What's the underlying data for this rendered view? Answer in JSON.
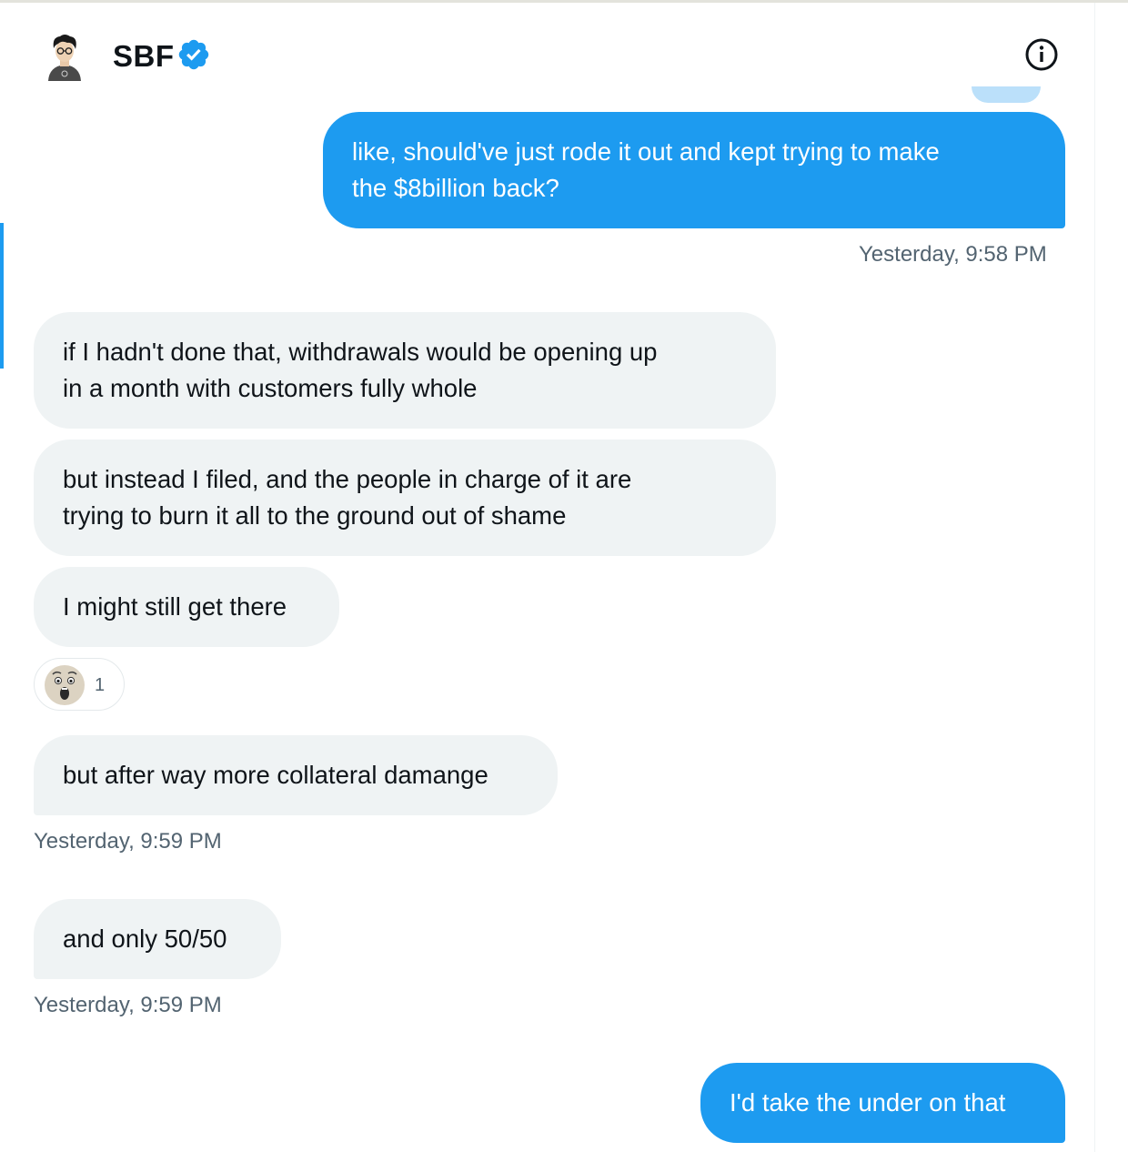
{
  "header": {
    "contact_name": "SBF",
    "verified_icon": "verified-badge-icon",
    "info_icon": "info-icon"
  },
  "colors": {
    "accent": "#1d9bf0",
    "received_bubble": "#eff3f4",
    "text_primary": "#0f1419",
    "text_secondary": "#536471"
  },
  "messages": [
    {
      "direction": "sent",
      "text_line1": "like, should've just rode it out and kept trying to make",
      "text_line2": "the $8billion back?"
    },
    {
      "direction": "received",
      "text_line1": "if I hadn't done that, withdrawals would be opening up",
      "text_line2": "in a month with customers fully whole"
    },
    {
      "direction": "received",
      "text_line1": "but instead I filed, and the people in charge of it are",
      "text_line2": "trying to burn it all to the ground out of shame"
    },
    {
      "direction": "received",
      "text": "I might still get there"
    },
    {
      "direction": "received",
      "text": "but after way more collateral damange"
    },
    {
      "direction": "received",
      "text": "and only 50/50"
    },
    {
      "direction": "sent",
      "text": "I'd take the under on that"
    }
  ],
  "timestamps": {
    "after_sent_1": "Yesterday, 9:58 PM",
    "after_received_group": "Yesterday, 9:59 PM",
    "after_fifty": "Yesterday, 9:59 PM"
  },
  "reaction": {
    "emoji": "shocked-face-emoji",
    "count": "1"
  }
}
